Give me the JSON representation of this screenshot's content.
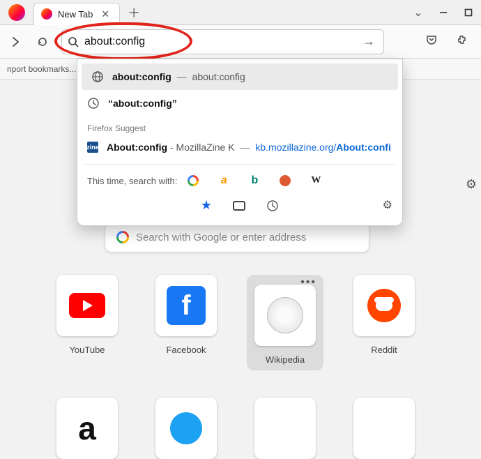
{
  "tab": {
    "title": "New Tab"
  },
  "urlbar": {
    "value": "about:config"
  },
  "bookmarksbar": {
    "import_text": "nport bookmarks..."
  },
  "suggestions": {
    "primary": {
      "title": "about:config",
      "subtitle": "about:config"
    },
    "search": {
      "quoted": "“about:config”"
    },
    "suggest_header": "Firefox Suggest",
    "external": {
      "title": "About:config",
      "source_prefix": "MozillaZine K",
      "url_prefix": "kb.mozillazine.org/",
      "url_bold": "About:confi"
    }
  },
  "search_with": {
    "label": "This time, search with:",
    "engines": [
      "Google",
      "Amazon",
      "Bing",
      "DuckDuckGo",
      "Wikipedia"
    ]
  },
  "home_search": {
    "placeholder": "Search with Google or enter address"
  },
  "topsites": [
    {
      "label": "YouTube"
    },
    {
      "label": "Facebook"
    },
    {
      "label": "Wikipedia"
    },
    {
      "label": "Reddit"
    }
  ]
}
